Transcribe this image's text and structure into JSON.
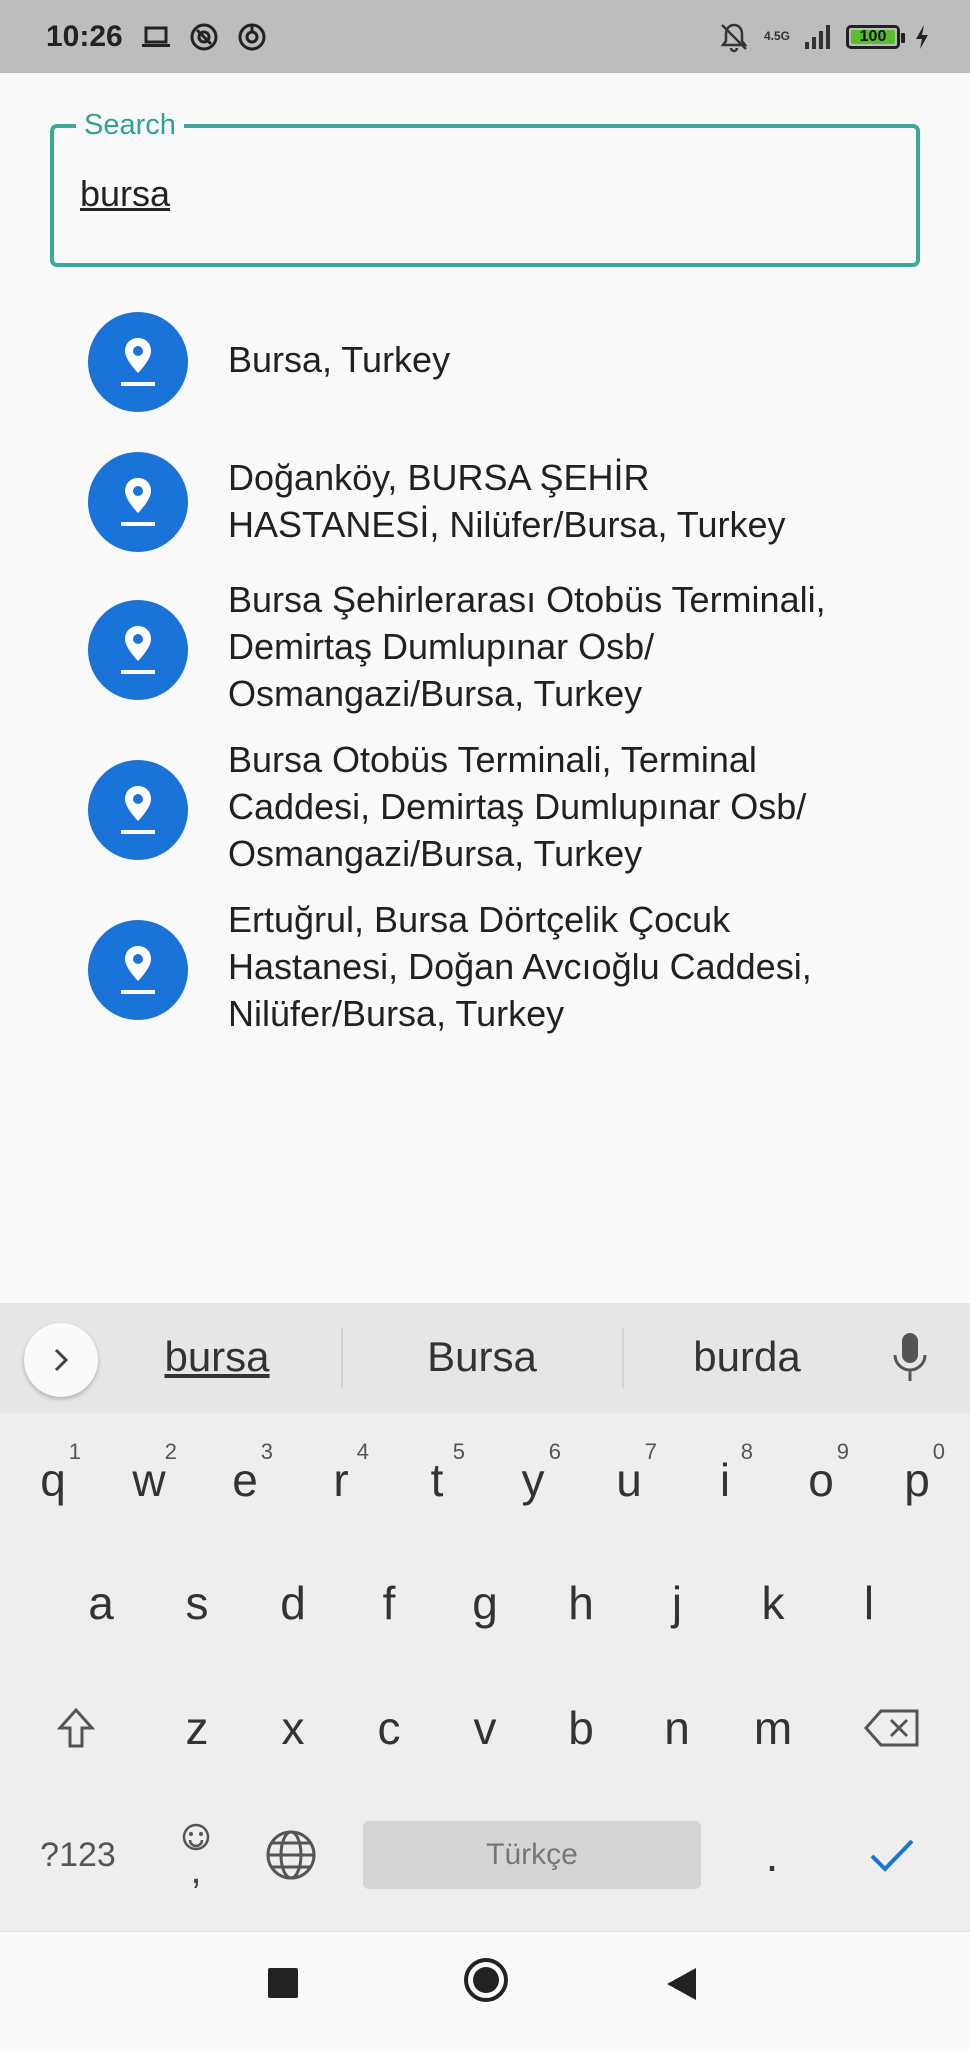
{
  "status_bar": {
    "time": "10:26",
    "left_icons": [
      "laptop-icon",
      "vpn-key-icon",
      "sync-circle-icon"
    ],
    "network_type": "4.5G",
    "battery_level": "100",
    "right_icons": [
      "bell-off-icon",
      "signal-icon",
      "battery-icon",
      "charging-bolt-icon"
    ]
  },
  "search": {
    "label": "Search",
    "value": "bursa",
    "accent_color": "#3aa89a"
  },
  "results": [
    {
      "icon": "location-pin-icon",
      "text": "Bursa, Turkey"
    },
    {
      "icon": "location-pin-icon",
      "text": "Doğanköy, BURSA ŞEHİR\nHASTANESİ, Nilüfer/Bursa, Turkey"
    },
    {
      "icon": "location-pin-icon",
      "text": "Bursa Şehirlerarası Otobüs Terminali,\nDemirtaş Dumlupınar Osb/\nOsmangazi/Bursa, Turkey"
    },
    {
      "icon": "location-pin-icon",
      "text": "Bursa Otobüs Terminali, Terminal\nCaddesi, Demirtaş Dumlupınar Osb/\nOsmangazi/Bursa, Turkey"
    },
    {
      "icon": "location-pin-icon",
      "text": "Ertuğrul, Bursa Dörtçelik Çocuk\nHastanesi, Doğan Avcıoğlu Caddesi,\nNilüfer/Bursa, Turkey"
    }
  ],
  "pin_color": "#1a73d9",
  "keyboard": {
    "suggestions": [
      "bursa",
      "Bursa",
      "burda"
    ],
    "row1": [
      {
        "k": "q",
        "n": "1"
      },
      {
        "k": "w",
        "n": "2"
      },
      {
        "k": "e",
        "n": "3"
      },
      {
        "k": "r",
        "n": "4"
      },
      {
        "k": "t",
        "n": "5"
      },
      {
        "k": "y",
        "n": "6"
      },
      {
        "k": "u",
        "n": "7"
      },
      {
        "k": "i",
        "n": "8"
      },
      {
        "k": "o",
        "n": "9"
      },
      {
        "k": "p",
        "n": "0"
      }
    ],
    "row2": [
      "a",
      "s",
      "d",
      "f",
      "g",
      "h",
      "j",
      "k",
      "l"
    ],
    "row3": [
      "z",
      "x",
      "c",
      "v",
      "b",
      "n",
      "m"
    ],
    "symbols_label": "?123",
    "emoji_comma": ",",
    "space_label": "Türkçe",
    "period": ".",
    "check_color": "#1a73d9"
  },
  "nav": [
    "recents-square-icon",
    "home-circle-icon",
    "back-triangle-icon"
  ]
}
